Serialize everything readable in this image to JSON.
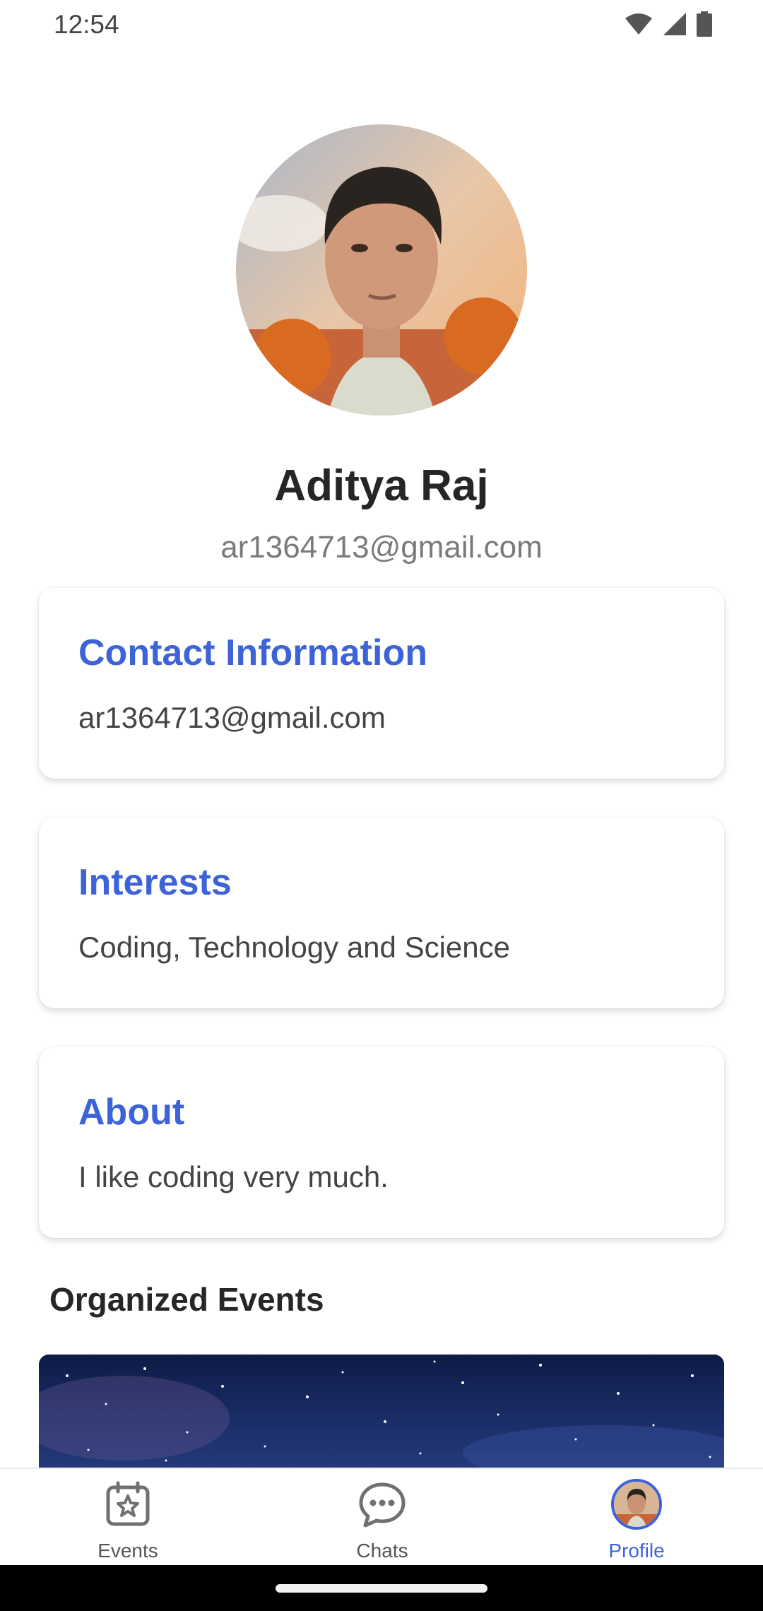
{
  "status_bar": {
    "time": "12:54",
    "icons": [
      "wifi-icon",
      "signal-icon",
      "battery-icon"
    ]
  },
  "profile": {
    "avatar_icon": "profile-photo",
    "name": "Aditya Raj",
    "email": "ar1364713@gmail.com"
  },
  "cards": {
    "contact": {
      "title": "Contact Information",
      "text": "ar1364713@gmail.com"
    },
    "interests": {
      "title": "Interests",
      "text": "Coding, Technology and Science"
    },
    "about": {
      "title": "About",
      "text": "I like coding very much."
    }
  },
  "organized_events": {
    "heading": "Organized Events"
  },
  "bottom_nav": {
    "items": [
      {
        "label": "Events",
        "icon": "calendar-star-icon",
        "active": false
      },
      {
        "label": "Chats",
        "icon": "chat-bubble-icon",
        "active": false
      },
      {
        "label": "Profile",
        "icon": "profile-avatar",
        "active": true
      }
    ]
  },
  "colors": {
    "accent": "#3d63d8",
    "title_text": "#262626",
    "muted_text": "#7a7a7a"
  }
}
